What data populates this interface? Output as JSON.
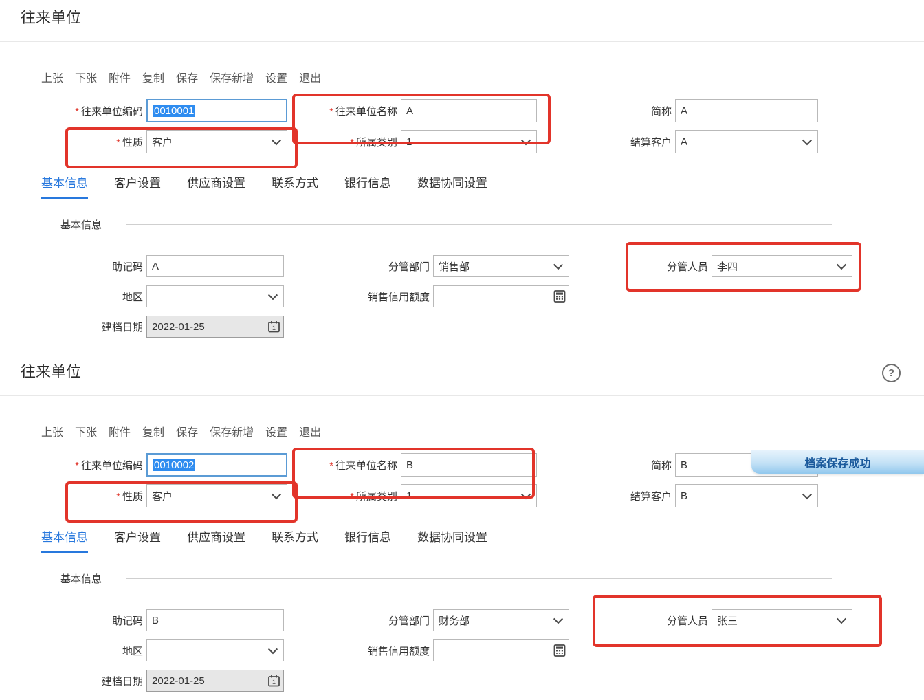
{
  "marks": {
    "required": "*"
  },
  "icons": {
    "help": "?"
  },
  "colors": {
    "accent_blue": "#2878dd",
    "annotation_red": "#e2342a",
    "selection_blue": "#2e8cf0",
    "toast_text_blue": "#1b5a9c"
  },
  "panels": [
    {
      "title": "往来单位",
      "toolbar": [
        "上张",
        "下张",
        "附件",
        "复制",
        "保存",
        "保存新增",
        "设置",
        "退出"
      ],
      "fields": {
        "code": {
          "label": "往来单位编码",
          "value": "0010001"
        },
        "name": {
          "label": "往来单位名称",
          "value": "A"
        },
        "abbr": {
          "label": "简称",
          "value": "A"
        },
        "nature": {
          "label": "性质",
          "value": "客户"
        },
        "category": {
          "label": "所属类别",
          "value": "1"
        },
        "settle": {
          "label": "结算客户",
          "value": "A"
        },
        "mnemonic": {
          "label": "助记码",
          "value": "A"
        },
        "department": {
          "label": "分管部门",
          "value": "销售部"
        },
        "person": {
          "label": "分管人员",
          "value": "李四"
        },
        "region": {
          "label": "地区",
          "value": ""
        },
        "credit": {
          "label": "销售信用额度",
          "value": ""
        },
        "created": {
          "label": "建档日期",
          "value": "2022-01-25"
        }
      },
      "tabs": [
        "基本信息",
        "客户设置",
        "供应商设置",
        "联系方式",
        "银行信息",
        "数据协同设置"
      ],
      "active_tab": "基本信息",
      "section_title": "基本信息"
    },
    {
      "title": "往来单位",
      "toolbar": [
        "上张",
        "下张",
        "附件",
        "复制",
        "保存",
        "保存新增",
        "设置",
        "退出"
      ],
      "fields": {
        "code": {
          "label": "往来单位编码",
          "value": "0010002"
        },
        "name": {
          "label": "往来单位名称",
          "value": "B"
        },
        "abbr": {
          "label": "简称",
          "value": "B"
        },
        "nature": {
          "label": "性质",
          "value": "客户"
        },
        "category": {
          "label": "所属类别",
          "value": "1"
        },
        "settle": {
          "label": "结算客户",
          "value": "B"
        },
        "mnemonic": {
          "label": "助记码",
          "value": "B"
        },
        "department": {
          "label": "分管部门",
          "value": "财务部"
        },
        "person": {
          "label": "分管人员",
          "value": "张三"
        },
        "region": {
          "label": "地区",
          "value": ""
        },
        "credit": {
          "label": "销售信用额度",
          "value": ""
        },
        "created": {
          "label": "建档日期",
          "value": "2022-01-25"
        }
      },
      "tabs": [
        "基本信息",
        "客户设置",
        "供应商设置",
        "联系方式",
        "银行信息",
        "数据协同设置"
      ],
      "active_tab": "基本信息",
      "section_title": "基本信息",
      "toast": "档案保存成功"
    }
  ]
}
